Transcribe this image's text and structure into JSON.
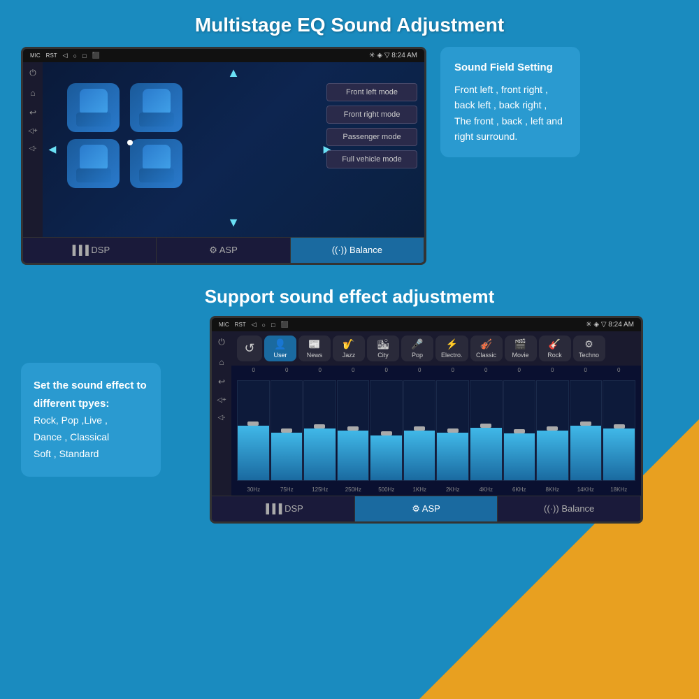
{
  "page": {
    "background_color": "#1a8bbf"
  },
  "section1": {
    "title": "Multistage EQ Sound Adjustment",
    "status_bar": {
      "left_items": [
        "MIC",
        "RST",
        "◁",
        "○",
        "□",
        "⬛🎥"
      ],
      "right_items": [
        "✳",
        "◈",
        "▽",
        "8:24 AM"
      ]
    },
    "side_icons": [
      "⏻",
      "🏠",
      "↩",
      "🔊-",
      "🔊+"
    ],
    "mode_buttons": [
      "Front left mode",
      "Front right mode",
      "Passenger mode",
      "Full vehicle mode"
    ],
    "nav_arrows": {
      "up": "▲",
      "down": "▼",
      "left": "◄",
      "right": "►"
    },
    "tabs": [
      {
        "label": "DSP",
        "active": false
      },
      {
        "label": "ASP",
        "active": false
      },
      {
        "label": "Balance",
        "active": true
      }
    ],
    "info_box": {
      "title": "Sound Field Setting",
      "body": "Front left , front right , back left , back right , The front , back , left and right surround."
    }
  },
  "section2": {
    "title": "Support sound effect adjustmemt",
    "status_bar": {
      "left_items": [
        "MIC",
        "RST",
        "◁",
        "○",
        "□",
        "⬛🎥"
      ],
      "right_items": [
        "✳",
        "◈",
        "▽",
        "8:24 AM"
      ]
    },
    "presets": [
      {
        "icon": "↺",
        "label": "",
        "active": false,
        "type": "refresh"
      },
      {
        "icon": "👤",
        "label": "User",
        "active": true
      },
      {
        "icon": "📰",
        "label": "News",
        "active": false
      },
      {
        "icon": "🎷",
        "label": "Jazz",
        "active": false
      },
      {
        "icon": "🏙",
        "label": "City",
        "active": false
      },
      {
        "icon": "🎤",
        "label": "Pop",
        "active": false
      },
      {
        "icon": "⚡",
        "label": "Electro.",
        "active": false
      },
      {
        "icon": "🎻",
        "label": "Classic",
        "active": false
      },
      {
        "icon": "🎬",
        "label": "Movie",
        "active": false
      },
      {
        "icon": "🎸",
        "label": "Rock",
        "active": false
      },
      {
        "icon": "⚙",
        "label": "Techno",
        "active": false
      }
    ],
    "eq_channels": [
      {
        "freq": "30Hz",
        "value": "0",
        "height_pct": 55
      },
      {
        "freq": "75Hz",
        "value": "0",
        "height_pct": 48
      },
      {
        "freq": "125Hz",
        "value": "0",
        "height_pct": 52
      },
      {
        "freq": "250Hz",
        "value": "0",
        "height_pct": 50
      },
      {
        "freq": "500Hz",
        "value": "0",
        "height_pct": 45
      },
      {
        "freq": "1KHz",
        "value": "0",
        "height_pct": 50
      },
      {
        "freq": "2KHz",
        "value": "0",
        "height_pct": 48
      },
      {
        "freq": "4KHz",
        "value": "0",
        "height_pct": 53
      },
      {
        "freq": "6KHz",
        "value": "0",
        "height_pct": 47
      },
      {
        "freq": "8KHz",
        "value": "0",
        "height_pct": 50
      },
      {
        "freq": "14KHz",
        "value": "0",
        "height_pct": 55
      },
      {
        "freq": "18KHz",
        "value": "0",
        "height_pct": 52
      }
    ],
    "tabs": [
      {
        "label": "DSP",
        "active": false
      },
      {
        "label": "ASP",
        "active": true
      },
      {
        "label": "Balance",
        "active": false
      }
    ],
    "info_box": {
      "title": "Set the sound effect to different tpyes:",
      "body": "Rock, Pop ,Live ,\nDance , Classical\nSoft , Standard"
    }
  }
}
